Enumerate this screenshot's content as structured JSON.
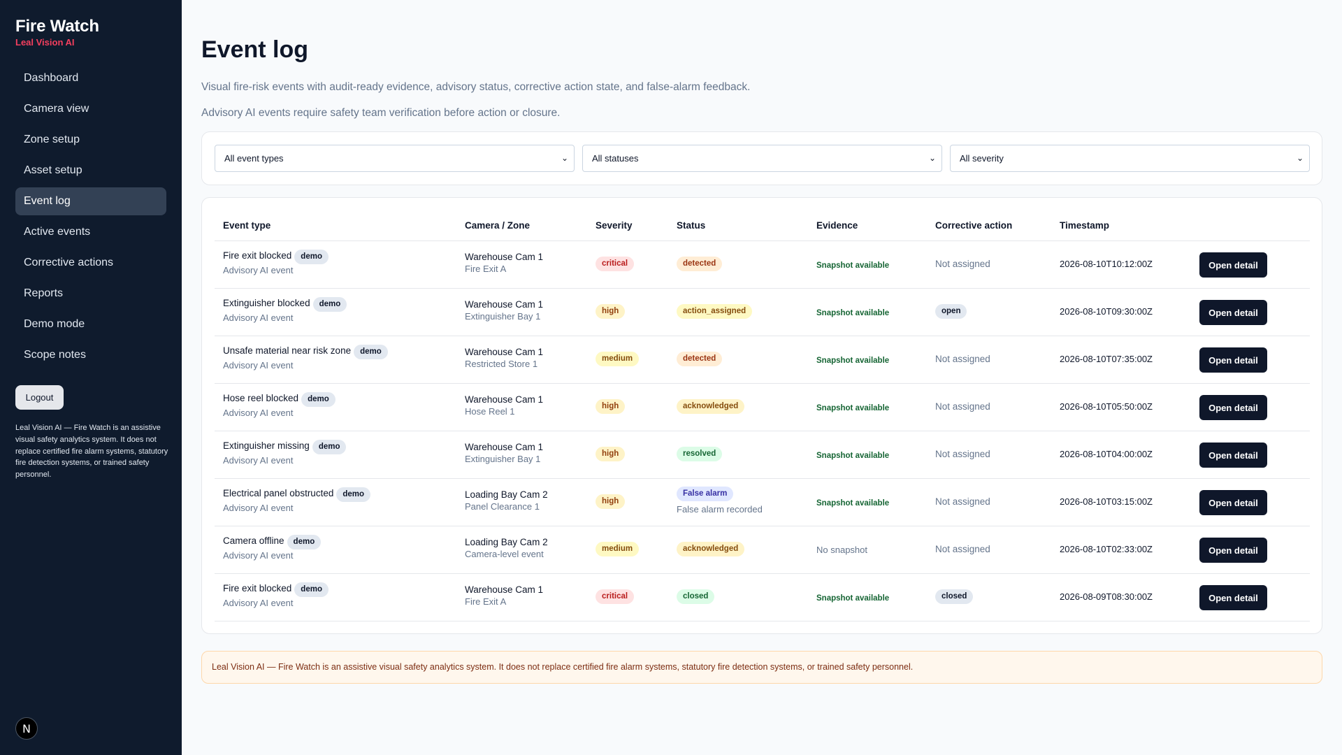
{
  "sidebar": {
    "brand_title": "Fire Watch",
    "brand_subtitle": "Leal Vision AI",
    "nav": [
      {
        "label": "Dashboard"
      },
      {
        "label": "Camera view"
      },
      {
        "label": "Zone setup"
      },
      {
        "label": "Asset setup"
      },
      {
        "label": "Event log",
        "active": true
      },
      {
        "label": "Active events"
      },
      {
        "label": "Corrective actions"
      },
      {
        "label": "Reports"
      },
      {
        "label": "Demo mode"
      },
      {
        "label": "Scope notes"
      }
    ],
    "logout_label": "Logout",
    "note": "Leal Vision AI — Fire Watch is an assistive visual safety analytics system. It does not replace certified fire alarm systems, statutory fire detection systems, or trained safety personnel.",
    "badge": "N"
  },
  "main": {
    "title": "Event log",
    "description": "Visual fire-risk events with audit-ready evidence, advisory status, corrective action state, and false-alarm feedback.",
    "advisory": "Advisory AI events require safety team verification before action or closure.",
    "filters": {
      "event_type": "All event types",
      "status": "All statuses",
      "severity": "All severity"
    },
    "columns": [
      "Event type",
      "Camera / Zone",
      "Severity",
      "Status",
      "Evidence",
      "Corrective action",
      "Timestamp"
    ],
    "open_label": "Open detail",
    "rows": [
      {
        "type": "Fire exit blocked",
        "tag": "demo",
        "source": "Advisory AI event",
        "camera": "Warehouse Cam 1",
        "zone": "Fire Exit A",
        "severity": "critical",
        "status": "detected",
        "status_note": "",
        "evidence": "Snapshot available",
        "action": "Not assigned",
        "action_chip": false,
        "timestamp": "2026-08-10T10:12:00Z"
      },
      {
        "type": "Extinguisher blocked",
        "tag": "demo",
        "source": "Advisory AI event",
        "camera": "Warehouse Cam 1",
        "zone": "Extinguisher Bay 1",
        "severity": "high",
        "status": "action_assigned",
        "status_note": "",
        "evidence": "Snapshot available",
        "action": "open",
        "action_chip": true,
        "timestamp": "2026-08-10T09:30:00Z"
      },
      {
        "type": "Unsafe material near risk zone",
        "tag": "demo",
        "source": "Advisory AI event",
        "camera": "Warehouse Cam 1",
        "zone": "Restricted Store 1",
        "severity": "medium",
        "status": "detected",
        "status_note": "",
        "evidence": "Snapshot available",
        "action": "Not assigned",
        "action_chip": false,
        "timestamp": "2026-08-10T07:35:00Z"
      },
      {
        "type": "Hose reel blocked",
        "tag": "demo",
        "source": "Advisory AI event",
        "camera": "Warehouse Cam 1",
        "zone": "Hose Reel 1",
        "severity": "high",
        "status": "acknowledged",
        "status_note": "",
        "evidence": "Snapshot available",
        "action": "Not assigned",
        "action_chip": false,
        "timestamp": "2026-08-10T05:50:00Z"
      },
      {
        "type": "Extinguisher missing",
        "tag": "demo",
        "source": "Advisory AI event",
        "camera": "Warehouse Cam 1",
        "zone": "Extinguisher Bay 1",
        "severity": "high",
        "status": "resolved",
        "status_note": "",
        "evidence": "Snapshot available",
        "action": "Not assigned",
        "action_chip": false,
        "timestamp": "2026-08-10T04:00:00Z"
      },
      {
        "type": "Electrical panel obstructed",
        "tag": "demo",
        "source": "Advisory AI event",
        "camera": "Loading Bay Cam 2",
        "zone": "Panel Clearance 1",
        "severity": "high",
        "status": "False alarm",
        "status_note": "False alarm recorded",
        "evidence": "Snapshot available",
        "action": "Not assigned",
        "action_chip": false,
        "timestamp": "2026-08-10T03:15:00Z"
      },
      {
        "type": "Camera offline",
        "tag": "demo",
        "source": "Advisory AI event",
        "camera": "Loading Bay Cam 2",
        "zone": "Camera-level event",
        "severity": "medium",
        "status": "acknowledged",
        "status_note": "",
        "evidence": "No snapshot",
        "action": "Not assigned",
        "action_chip": false,
        "timestamp": "2026-08-10T02:33:00Z"
      },
      {
        "type": "Fire exit blocked",
        "tag": "demo",
        "source": "Advisory AI event",
        "camera": "Warehouse Cam 1",
        "zone": "Fire Exit A",
        "severity": "critical",
        "status": "closed",
        "status_note": "",
        "evidence": "Snapshot available",
        "action": "closed",
        "action_chip": true,
        "timestamp": "2026-08-09T08:30:00Z"
      }
    ],
    "footer": "Leal Vision AI — Fire Watch is an assistive visual safety analytics system. It does not replace certified fire alarm systems, statutory fire detection systems, or trained safety personnel."
  }
}
